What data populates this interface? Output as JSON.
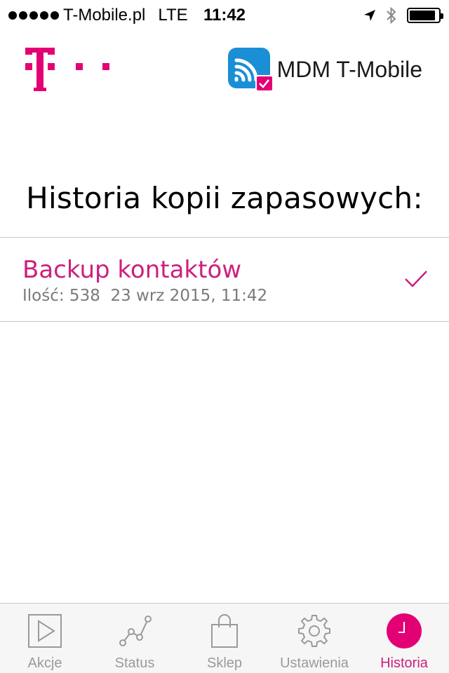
{
  "status_bar": {
    "carrier": "T-Mobile.pl",
    "network": "LTE",
    "time": "11:42",
    "icons": [
      "location-arrow-icon",
      "bluetooth-icon",
      "battery-icon"
    ],
    "battery_level": 0.9
  },
  "header": {
    "brand_logo": "t-mobile-logo",
    "app_icon": "mdm-app-icon",
    "app_name": "MDM T-Mobile"
  },
  "page": {
    "title": "Historia kopii zapasowych:"
  },
  "backups": [
    {
      "title": "Backup kontaktów",
      "subtitle": "Ilość: 538  23 wrz 2015, 11:42",
      "status_icon": "checkmark-icon"
    }
  ],
  "tabbar": {
    "tabs": [
      {
        "label": "Akcje",
        "icon": "play-icon",
        "active": false
      },
      {
        "label": "Status",
        "icon": "chart-line-icon",
        "active": false
      },
      {
        "label": "Sklep",
        "icon": "shopping-bag-icon",
        "active": false
      },
      {
        "label": "Ustawienia",
        "icon": "gear-icon",
        "active": false
      },
      {
        "label": "Historia",
        "icon": "clock-icon",
        "active": true
      }
    ]
  },
  "colors": {
    "accent": "#cc1f7f",
    "app_icon_blue": "#1a8fd6",
    "inactive_tab": "#9a9a9a",
    "separator": "#c8c8c8"
  }
}
